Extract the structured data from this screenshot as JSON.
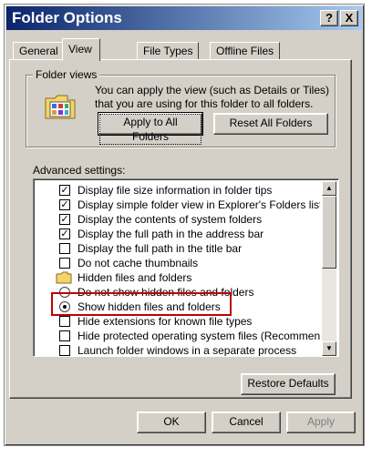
{
  "window": {
    "title": "Folder Options",
    "help_label": "?",
    "close_label": "X"
  },
  "tabs": [
    {
      "label": "General",
      "active": false
    },
    {
      "label": "View",
      "active": true
    },
    {
      "label": "File Types",
      "active": false
    },
    {
      "label": "Offline Files",
      "active": false
    }
  ],
  "folder_views": {
    "group_label": "Folder views",
    "description": "You can apply the view (such as Details or Tiles) that you are using for this folder to all folders.",
    "apply_button": "Apply to All Folders",
    "reset_button": "Reset All Folders",
    "icon": "folder-views-icon"
  },
  "advanced": {
    "label": "Advanced settings:",
    "items": [
      {
        "type": "checkbox",
        "checked": true,
        "label": "Display file size information in folder tips"
      },
      {
        "type": "checkbox",
        "checked": true,
        "label": "Display simple folder view in Explorer's Folders list"
      },
      {
        "type": "checkbox",
        "checked": true,
        "label": "Display the contents of system folders"
      },
      {
        "type": "checkbox",
        "checked": true,
        "label": "Display the full path in the address bar"
      },
      {
        "type": "checkbox",
        "checked": false,
        "label": "Display the full path in the title bar"
      },
      {
        "type": "checkbox",
        "checked": false,
        "label": "Do not cache thumbnails"
      },
      {
        "type": "folder",
        "label": "Hidden files and folders"
      },
      {
        "type": "radio",
        "checked": false,
        "label": "Do not show hidden files and folders"
      },
      {
        "type": "radio",
        "checked": true,
        "label": "Show hidden files and folders"
      },
      {
        "type": "checkbox",
        "checked": false,
        "label": "Hide extensions for known file types"
      },
      {
        "type": "checkbox",
        "checked": false,
        "label": "Hide protected operating system files (Recommended)"
      },
      {
        "type": "checkbox",
        "checked": false,
        "label": "Launch folder windows in a separate process"
      }
    ],
    "scroll_up_glyph": "▲",
    "scroll_down_glyph": "▼",
    "check_glyph": "✓"
  },
  "restore_button": "Restore Defaults",
  "footer": {
    "ok": "OK",
    "cancel": "Cancel",
    "apply": "Apply"
  },
  "colors": {
    "title_gradient_start": "#0a246a",
    "title_gradient_end": "#a6caf0",
    "face": "#d4d0c8",
    "highlight_box": "#c00000"
  }
}
